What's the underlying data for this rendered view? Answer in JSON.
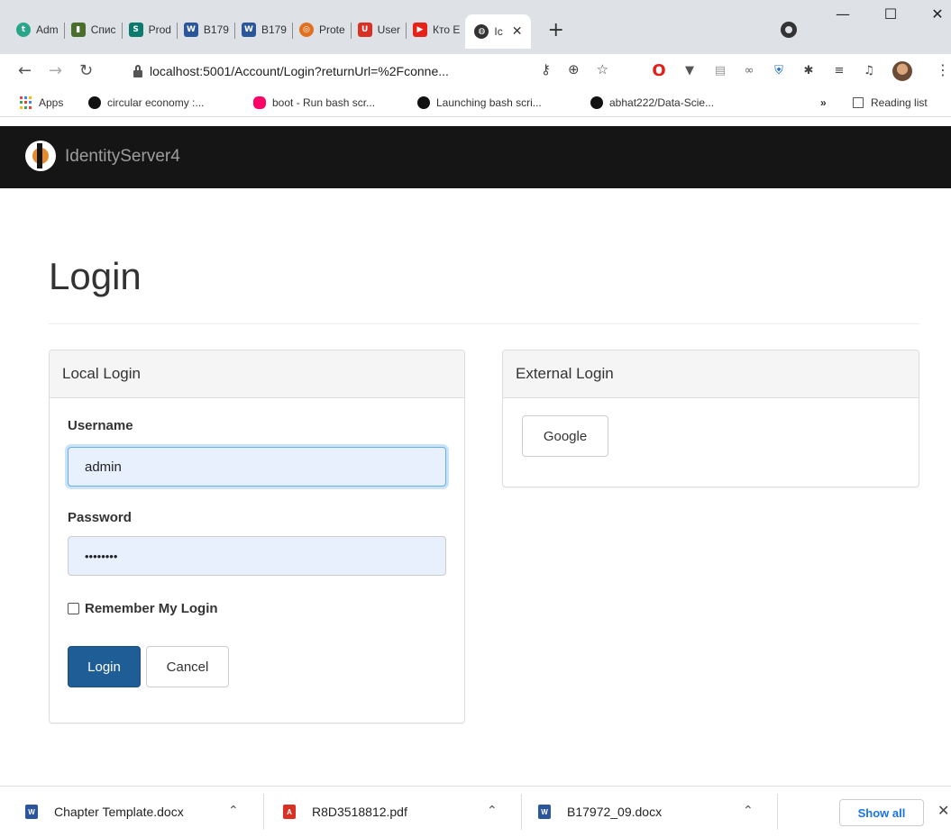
{
  "browser": {
    "tabs": [
      {
        "label": "Adm",
        "icon": "teal-circle-icon",
        "color": "#2aa58a"
      },
      {
        "label": "Спис",
        "icon": "chart-icon",
        "color": "#4a6f2c"
      },
      {
        "label": "Prod",
        "icon": "sharepoint-icon",
        "color": "#0a7a6f"
      },
      {
        "label": "B179",
        "icon": "word-icon",
        "color": "#2b579a"
      },
      {
        "label": "B179",
        "icon": "word-icon",
        "color": "#2b579a"
      },
      {
        "label": "Prote",
        "icon": "protect-icon",
        "color": "#e07020"
      },
      {
        "label": "User",
        "icon": "u-icon",
        "color": "#d93025"
      },
      {
        "label": "Кто Е",
        "icon": "youtube-icon",
        "color": "#e62117"
      },
      {
        "label": "Ic",
        "icon": "globe-icon",
        "color": "#333333"
      }
    ],
    "url": "localhost:5001/Account/Login?returnUrl=%2Fconne...",
    "bookmarks": [
      {
        "label": "Apps",
        "icon": "apps-grid-icon"
      },
      {
        "label": "circular economy :...",
        "icon": "circle-dot-icon"
      },
      {
        "label": "boot - Run bash scr...",
        "icon": "flower-icon"
      },
      {
        "label": "Launching bash scri...",
        "icon": "github-icon"
      },
      {
        "label": "abhat222/Data-Scie...",
        "icon": "github-icon"
      }
    ],
    "reading_list": "Reading list",
    "more": "»"
  },
  "page": {
    "brand": "IdentityServer4",
    "title": "Login",
    "local_login": {
      "heading": "Local Login",
      "username_label": "Username",
      "username_value": "admin",
      "password_label": "Password",
      "password_value": "••••••••",
      "remember_label": "Remember My Login",
      "login_button": "Login",
      "cancel_button": "Cancel"
    },
    "external_login": {
      "heading": "External Login",
      "google_button": "Google"
    }
  },
  "downloads": {
    "items": [
      {
        "name": "Chapter Template.docx",
        "type": "docx"
      },
      {
        "name": "R8D3518812.pdf",
        "type": "pdf"
      },
      {
        "name": "B17972_09.docx",
        "type": "docx"
      }
    ],
    "show_all": "Show all"
  },
  "colors": {
    "navbar": "#151515",
    "primary": "#1f5d97",
    "input_autofill": "#e8f0fe"
  }
}
